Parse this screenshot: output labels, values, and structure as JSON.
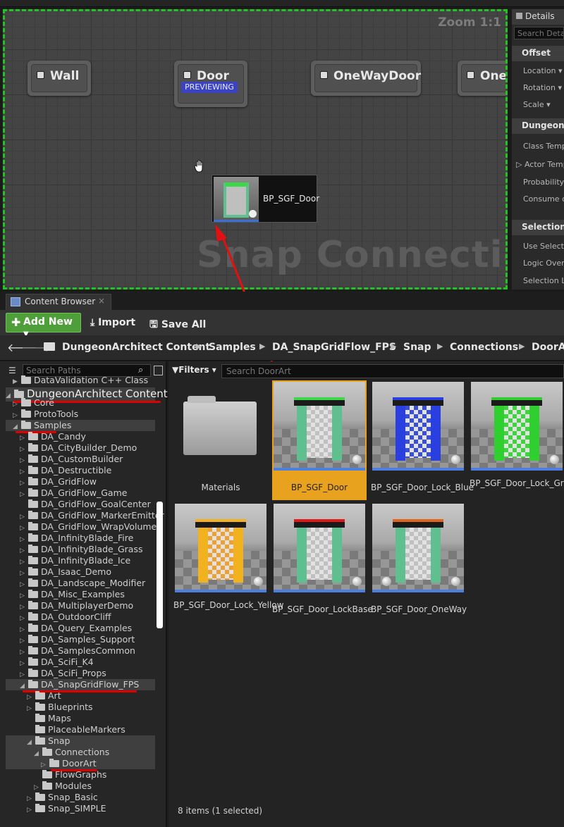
{
  "graph": {
    "zoom": "Zoom 1:1",
    "watermark": "Snap Connection",
    "nodes": [
      {
        "label": "Wall"
      },
      {
        "label": "Door",
        "badge": "PREVIEWING"
      },
      {
        "label": "OneWayDoor"
      },
      {
        "label": "One"
      }
    ],
    "drag_item": "BP_SGF_Door"
  },
  "details": {
    "tab": "Details",
    "search_placeholder": "Search Details",
    "categories": [
      {
        "name": "Offset",
        "props": [
          "Location",
          "Rotation",
          "Scale"
        ]
      },
      {
        "name": "Dungeon",
        "props": [
          "Class Temp",
          "Actor Temp",
          "Probability",
          "Consume o"
        ]
      },
      {
        "name": "Selection L",
        "props": [
          "Use Select",
          "Logic Over",
          "Selection L"
        ]
      }
    ]
  },
  "content_browser": {
    "tab": "Content Browser",
    "toolbar": {
      "add_new": "Add New",
      "import": "Import",
      "save_all": "Save All"
    },
    "breadcrumbs": [
      "DungeonArchitect Content",
      "Samples",
      "DA_SnapGridFlow_FPS",
      "Snap",
      "Connections",
      "DoorArt"
    ],
    "path_search_placeholder": "Search Paths",
    "filters_label": "Filters",
    "asset_search_placeholder": "Search DoorArt",
    "tree": [
      "DataValidation C++ Class",
      "DungeonArchitect Content",
      "Core",
      "ProtoTools",
      "Samples",
      "DA_Candy",
      "DA_CityBuilder_Demo",
      "DA_CustomBuilder",
      "DA_Destructible",
      "DA_GridFlow",
      "DA_GridFlow_Game",
      "DA_GridFlow_GoalCenter",
      "DA_GridFlow_MarkerEmitter",
      "DA_GridFlow_WrapVolume",
      "DA_InfinityBlade_Fire",
      "DA_InfinityBlade_Grass",
      "DA_InfinityBlade_Ice",
      "DA_Isaac_Demo",
      "DA_Landscape_Modifier",
      "DA_Misc_Examples",
      "DA_MultiplayerDemo",
      "DA_OutdoorCliff",
      "DA_Query_Examples",
      "DA_Samples_Support",
      "DA_SamplesCommon",
      "DA_SciFi_K4",
      "DA_SciFi_Props",
      "DA_SnapGridFlow_FPS",
      "Art",
      "Blueprints",
      "Maps",
      "PlaceableMarkers",
      "Snap",
      "Connections",
      "DoorArt",
      "FlowGraphs",
      "Modules",
      "Snap_Basic",
      "Snap_SIMPLE"
    ],
    "assets": [
      {
        "name": "Materials",
        "kind": "folder"
      },
      {
        "name": "BP_SGF_Door",
        "color": "#3bd84a"
      },
      {
        "name": "BP_SGF_Door_Lock_Blue",
        "color": "#2a3fe0"
      },
      {
        "name": "BP_SGF_Door_Lock_Green",
        "color": "#2ecf2e"
      },
      {
        "name": "BP_SGF_Door_Lock_Yellow",
        "color": "#f2b21f"
      },
      {
        "name": "BP_SGF_Door_LockBase",
        "color": "#e01818"
      },
      {
        "name": "BP_SGF_Door_OneWay",
        "color": "#e0641a"
      }
    ],
    "status": "8 items (1 selected)"
  }
}
